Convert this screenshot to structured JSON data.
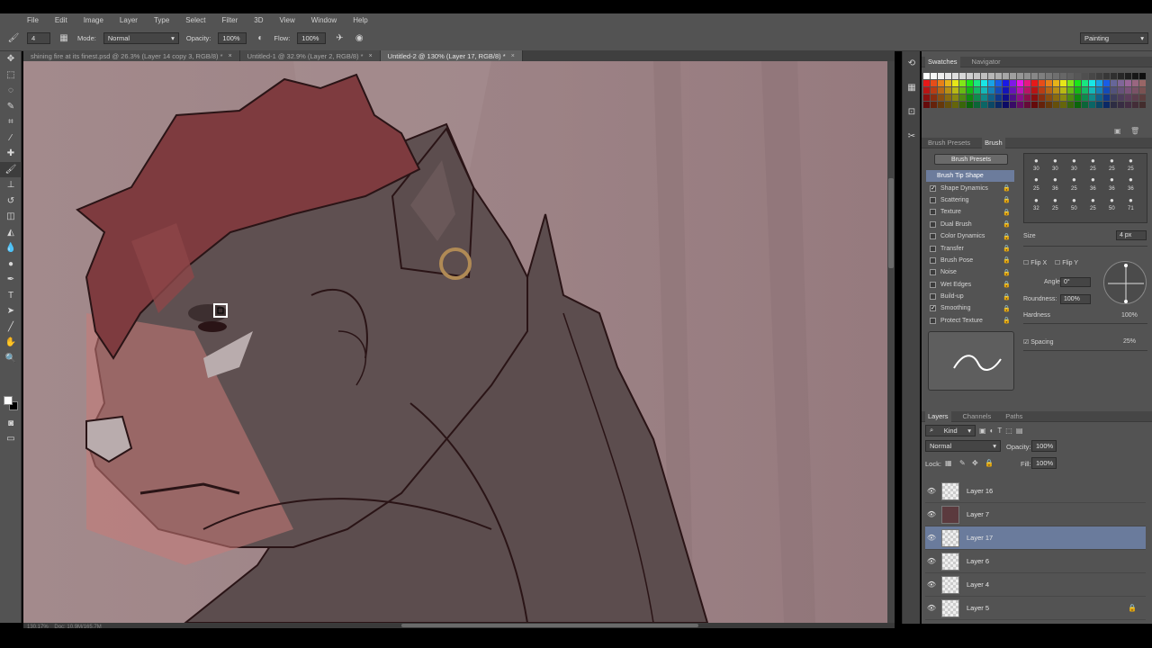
{
  "menu": [
    "File",
    "Edit",
    "Image",
    "Layer",
    "Type",
    "Select",
    "Filter",
    "3D",
    "View",
    "Window",
    "Help"
  ],
  "options_bar": {
    "brush_size": "4",
    "mode_label": "Mode:",
    "mode_value": "Normal",
    "opacity_label": "Opacity:",
    "opacity_value": "100%",
    "flow_label": "Flow:",
    "flow_value": "100%",
    "workspace": "Painting"
  },
  "document_tabs": [
    {
      "label": "shining fire at its finest.psd @ 26.3% (Layer 14 copy 3, RGB/8) *",
      "active": false
    },
    {
      "label": "Untitled-1 @ 32.9% (Layer 2, RGB/8) *",
      "active": false
    },
    {
      "label": "Untitled-2 @ 130% (Layer 17, RGB/8) *",
      "active": true
    }
  ],
  "status": {
    "zoom": "130.17%",
    "doc": "Doc: 10.9M/165.7M"
  },
  "swatches_panel": {
    "tabs": [
      "Swatches",
      "Navigator"
    ]
  },
  "brush_panel": {
    "tabs": [
      "Brush Presets",
      "Brush"
    ],
    "presets_button": "Brush Presets",
    "options": [
      {
        "label": "Brush Tip Shape",
        "checked": null,
        "header": true
      },
      {
        "label": "Shape Dynamics",
        "checked": true
      },
      {
        "label": "Scattering",
        "checked": false
      },
      {
        "label": "Texture",
        "checked": false
      },
      {
        "label": "Dual Brush",
        "checked": false
      },
      {
        "label": "Color Dynamics",
        "checked": false
      },
      {
        "label": "Transfer",
        "checked": false
      },
      {
        "label": "Brush Pose",
        "checked": false
      },
      {
        "label": "Noise",
        "checked": false
      },
      {
        "label": "Wet Edges",
        "checked": false
      },
      {
        "label": "Build-up",
        "checked": false
      },
      {
        "label": "Smoothing",
        "checked": true
      },
      {
        "label": "Protect Texture",
        "checked": false
      }
    ],
    "tip_sizes": [
      "30",
      "30",
      "30",
      "25",
      "25",
      "25",
      "25",
      "36",
      "25",
      "36",
      "36",
      "36",
      "32",
      "25",
      "50",
      "25",
      "50",
      "71"
    ],
    "size_label": "Size",
    "size_value": "4 px",
    "flip_x": "Flip X",
    "flip_y": "Flip Y",
    "angle_label": "Angle:",
    "angle_value": "0°",
    "roundness_label": "Roundness:",
    "roundness_value": "100%",
    "hardness_label": "Hardness",
    "hardness_value": "100%",
    "spacing_label": "Spacing",
    "spacing_value": "25%"
  },
  "layers_panel": {
    "tabs": [
      "Layers",
      "Channels",
      "Paths"
    ],
    "kind_label": "Kind",
    "blend_mode": "Normal",
    "opacity_label": "Opacity:",
    "opacity_value": "100%",
    "lock_label": "Lock:",
    "fill_label": "Fill:",
    "fill_value": "100%",
    "layers": [
      {
        "name": "Layer 16",
        "selected": false,
        "dark": false,
        "locked": false
      },
      {
        "name": "Layer 7",
        "selected": false,
        "dark": true,
        "locked": false
      },
      {
        "name": "Layer 17",
        "selected": true,
        "dark": false,
        "locked": false
      },
      {
        "name": "Layer 6",
        "selected": false,
        "dark": false,
        "locked": false
      },
      {
        "name": "Layer 4",
        "selected": false,
        "dark": false,
        "locked": false
      },
      {
        "name": "Layer 5",
        "selected": false,
        "dark": false,
        "locked": true
      }
    ]
  },
  "colors": {
    "ui_bg": "#535353",
    "canvas_bg": "#9b8083",
    "selection": "#6a7b9c",
    "fur": "#5c4d4e",
    "hair": "#7e3b3f",
    "glow": "#c97a78",
    "lineart": "#2a1416",
    "earring": "#b08a55"
  }
}
